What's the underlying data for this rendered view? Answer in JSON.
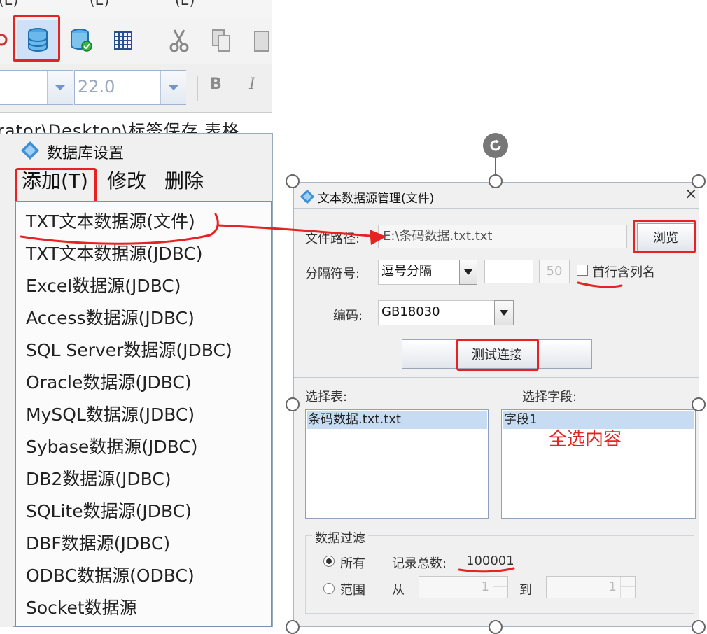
{
  "app": {
    "menubar": [
      {
        "label": "(E)"
      },
      {
        "label": "(E)"
      },
      {
        "label": "(E)"
      }
    ],
    "toolbar_icons": [
      "database-icon",
      "database-connect-icon",
      "grid-icon",
      "cut-icon",
      "copy-icon",
      "paste-icon"
    ],
    "font_size_value": "22.0",
    "bold_label": "B",
    "italic_label": "I",
    "path_fragment": "rator\\Desktop\\标签保存   表格"
  },
  "db_window": {
    "title": "数据库设置",
    "menu": {
      "add": "添加(T)",
      "modify": "修改",
      "delete": "删除"
    },
    "dropdown_items": [
      "TXT文本数据源(文件)",
      "TXT文本数据源(JDBC)",
      "Excel数据源(JDBC)",
      "Access数据源(JDBC)",
      "SQL Server数据源(JDBC)",
      "Oracle数据源(JDBC)",
      "MySQL数据源(JDBC)",
      "Sybase数据源(JDBC)",
      "DB2数据源(JDBC)",
      "SQLite数据源(JDBC)",
      "DBF数据源(JDBC)",
      "ODBC数据源(ODBC)",
      "Socket数据源"
    ]
  },
  "dialog": {
    "title": "文本数据源管理(文件)",
    "close": "×",
    "file_path_label": "文件路径:",
    "file_path_value": "E:\\条码数据.txt.txt",
    "browse": "浏览",
    "delimiter_label": "分隔符号:",
    "delimiter_value": "逗号分隔",
    "delimiter_custom": "",
    "max_value": "50",
    "first_row_header": "首行含列名",
    "encoding_label": "编码:",
    "encoding_value": "GB18030",
    "test_connection": "测试连接",
    "select_table_label": "选择表:",
    "select_field_label": "选择字段:",
    "tables": [
      "条码数据.txt.txt"
    ],
    "fields": [
      "字段1"
    ],
    "annotation_select_all": "全选内容",
    "filter": {
      "title": "数据过滤",
      "all_label": "所有",
      "total_label": "记录总数:",
      "total_value": "100001",
      "range_label": "范围",
      "from_label": "从",
      "from_value": "1",
      "to_label": "到",
      "to_value": "1"
    }
  },
  "colors": {
    "annotation_red": "#e62222",
    "selection_blue": "#c7dbf2",
    "window_bg": "#f0f0f0"
  }
}
